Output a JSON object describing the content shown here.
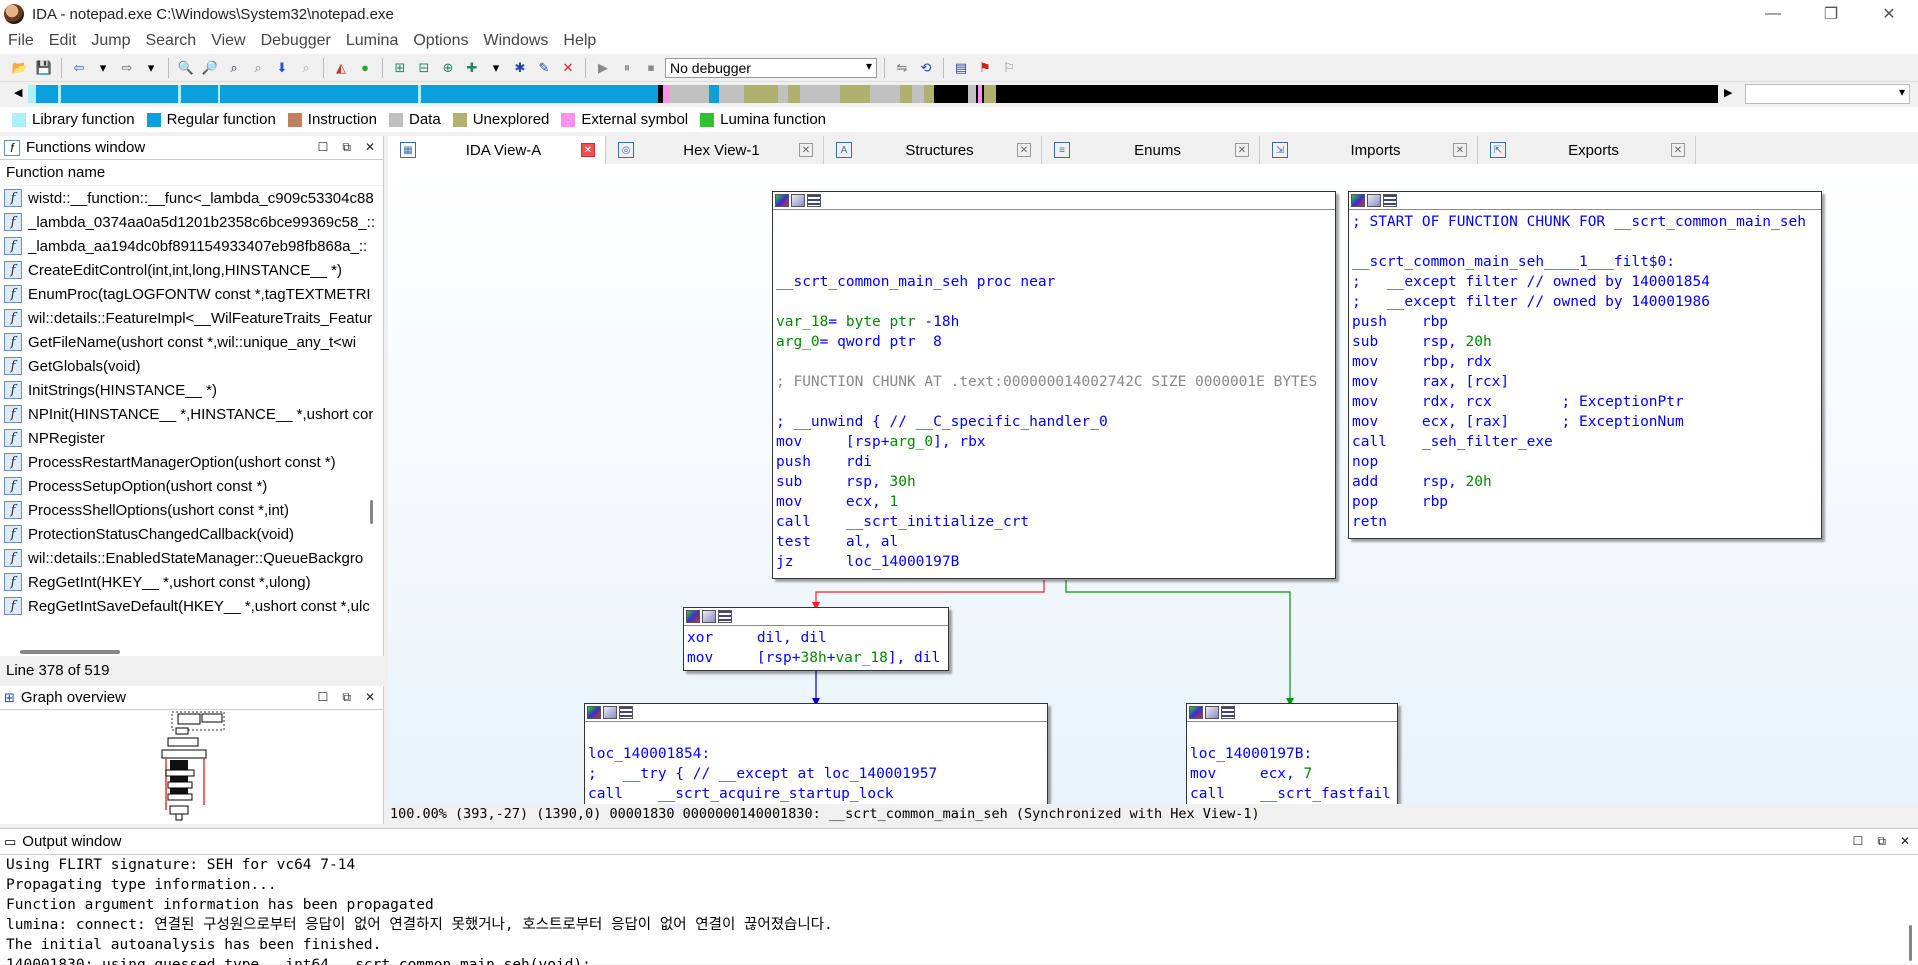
{
  "window": {
    "title": "IDA - notepad.exe C:\\Windows\\System32\\notepad.exe",
    "controls": [
      "—",
      "❐",
      "✕"
    ]
  },
  "menu": [
    "File",
    "Edit",
    "Jump",
    "Search",
    "View",
    "Debugger",
    "Lumina",
    "Options",
    "Windows",
    "Help"
  ],
  "toolbar": {
    "debugger_select": "No debugger"
  },
  "legend": [
    {
      "label": "Library function",
      "color": "#aaf0f8"
    },
    {
      "label": "Regular function",
      "color": "#0aa0e0"
    },
    {
      "label": "Instruction",
      "color": "#c08060"
    },
    {
      "label": "Data",
      "color": "#c0c0c0"
    },
    {
      "label": "Unexplored",
      "color": "#b0b070"
    },
    {
      "label": "External symbol",
      "color": "#ff90f0"
    },
    {
      "label": "Lumina function",
      "color": "#30c030"
    }
  ],
  "functions_window": {
    "title": "Functions window",
    "column": "Function name",
    "items": [
      "wistd::__function::__func<_lambda_c909c53304c88",
      "_lambda_0374aa0a5d1201b2358c6bce99369c58_::",
      "_lambda_aa194dc0bf891154933407eb98fb868a_::",
      "CreateEditControl(int,int,long,HINSTANCE__ *)",
      "EnumProc(tagLOGFONTW const *,tagTEXTMETRI",
      "wil::details::FeatureImpl<__WilFeatureTraits_Featur",
      "GetFileName(ushort const *,wil::unique_any_t<wi",
      "GetGlobals(void)",
      "InitStrings(HINSTANCE__ *)",
      "NPInit(HINSTANCE__ *,HINSTANCE__ *,ushort cor",
      "NPRegister",
      "ProcessRestartManagerOption(ushort const *)",
      "ProcessSetupOption(ushort const *)",
      "ProcessShellOptions(ushort const *,int)",
      "ProtectionStatusChangedCallback(void)",
      "wil::details::EnabledStateManager::QueueBackgro",
      "RegGetInt(HKEY__ *,ushort const *,ulong)",
      "RegGetIntSaveDefault(HKEY__ *,ushort const *,ulc"
    ],
    "line_info": "Line 378 of 519"
  },
  "graph_overview": {
    "title": "Graph overview"
  },
  "tabs": [
    {
      "label": "IDA View-A",
      "icon": "ida-view-icon"
    },
    {
      "label": "Hex View-1",
      "icon": "hex-icon"
    },
    {
      "label": "Structures",
      "icon": "structures-icon"
    },
    {
      "label": "Enums",
      "icon": "enums-icon"
    },
    {
      "label": "Imports",
      "icon": "imports-icon"
    },
    {
      "label": "Exports",
      "icon": "exports-icon"
    }
  ],
  "nodes": {
    "main": [
      "",
      "",
      "",
      "__scrt_common_main_seh proc near",
      "",
      "var_18= byte ptr -18h",
      "arg_0= qword ptr  8",
      "",
      "; FUNCTION CHUNK AT .text:000000014002742C SIZE 0000001E BYTES",
      "",
      "; __unwind { // __C_specific_handler_0",
      "mov     [rsp+arg_0], rbx",
      "push    rdi",
      "sub     rsp, 30h",
      "mov     ecx, 1",
      "call    __scrt_initialize_crt",
      "test    al, al",
      "jz      loc_14000197B"
    ],
    "filter": [
      "; START OF FUNCTION CHUNK FOR __scrt_common_main_seh",
      "",
      "__scrt_common_main_seh____1___filt$0:",
      ";   __except filter // owned by 140001854",
      ";   __except filter // owned by 140001986",
      "push    rbp",
      "sub     rsp, 20h",
      "mov     rbp, rdx",
      "mov     rax, [rcx]",
      "mov     rdx, rcx        ; ExceptionPtr",
      "mov     ecx, [rax]      ; ExceptionNum",
      "call    _seh_filter_exe",
      "nop",
      "add     rsp, 20h",
      "pop     rbp",
      "retn"
    ],
    "xor_block": [
      "xor     dil, dil",
      "mov     [rsp+38h+var_18], dil"
    ],
    "loc_854": [
      "",
      "loc_140001854:",
      ";   __try { // __except at loc_140001957",
      "call    __scrt_acquire_startup_lock"
    ],
    "loc_97b": [
      "",
      "loc_14000197B:",
      "mov     ecx, 7",
      "call    __scrt_fastfail"
    ]
  },
  "status": "100.00% (393,-27) (1390,0) 00001830 0000000140001830: __scrt_common_main_seh (Synchronized with Hex View-1)",
  "output_window": {
    "title": "Output window",
    "lines": [
      "Using FLIRT signature: SEH for vc64 7-14",
      "Propagating type information...",
      "Function argument information has been propagated",
      "lumina: connect: 연결된 구성원으로부터 응답이 없어 연결하지 못했거나, 호스트로부터 응답이 없어 연결이 끊어졌습니다.",
      "The initial autoanalysis has been finished.",
      "140001830: using guessed type __int64 __scrt_common_main_seh(void);"
    ]
  }
}
